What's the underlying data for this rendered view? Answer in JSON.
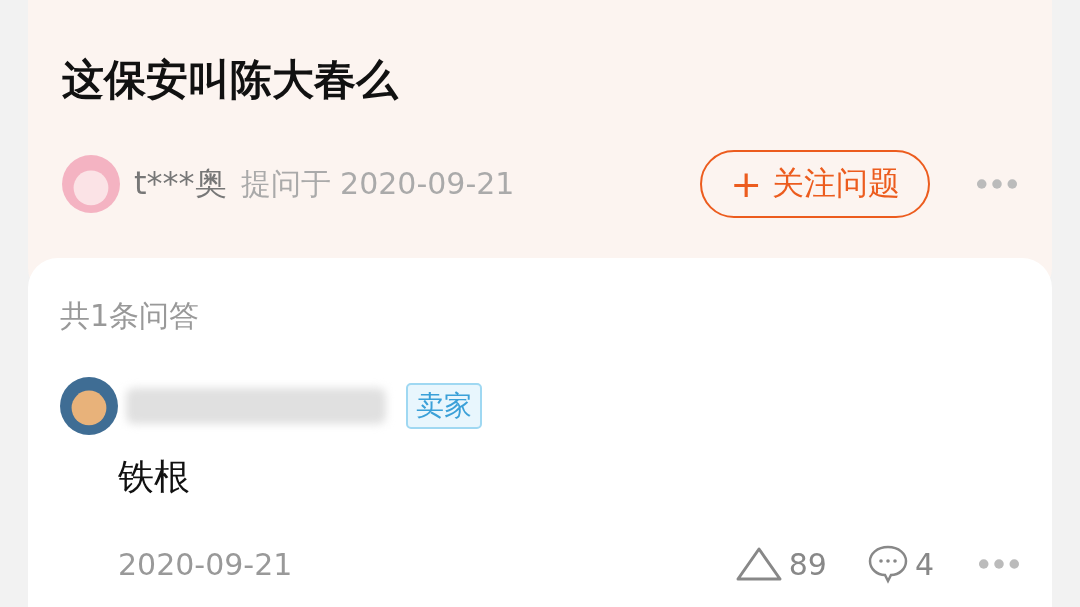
{
  "question": {
    "title": "这保安叫陈大春么",
    "asker": "t***奥",
    "asked_label": "提问于 2020-09-21",
    "follow_button": {
      "icon": "+",
      "label": "关注问题"
    }
  },
  "answers": {
    "count_label": "共1条问答",
    "items": [
      {
        "seller_badge": "卖家",
        "text": "铁根",
        "date": "2020-09-21",
        "likes": "89",
        "comments": "4"
      }
    ]
  }
}
